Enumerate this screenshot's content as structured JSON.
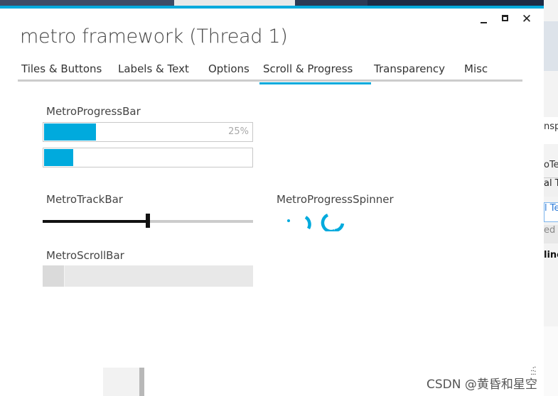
{
  "window": {
    "title": "metro framework (Thread 1)",
    "accent_color": "#00aadd",
    "close_glyph": "✕"
  },
  "tabs": [
    {
      "label": "Tiles & Buttons",
      "active": false
    },
    {
      "label": "Labels & Text",
      "active": false
    },
    {
      "label": "Options",
      "active": false
    },
    {
      "label": "Scroll & Progress",
      "active": true
    },
    {
      "label": "Transparency",
      "active": false
    },
    {
      "label": "Misc",
      "active": false
    }
  ],
  "progress": {
    "label": "MetroProgressBar",
    "bar1_percent_text": "25%",
    "bar1_value": 25,
    "bar2_value": 14
  },
  "trackbar": {
    "label": "MetroTrackBar",
    "value": 50
  },
  "spinner": {
    "label": "MetroProgressSpinner"
  },
  "scrollbar": {
    "label": "MetroScrollBar"
  },
  "background": {
    "right_texts": [
      "nspa",
      "oTe",
      "al T",
      "l Tex",
      "ed",
      "line"
    ]
  },
  "watermark": "CSDN @黄昏和星空"
}
